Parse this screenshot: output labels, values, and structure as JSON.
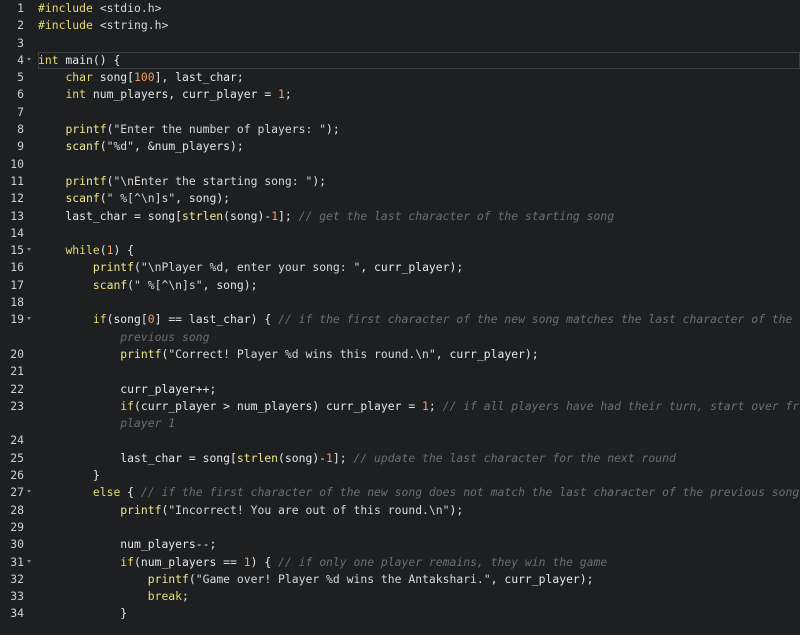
{
  "editor": {
    "lines": [
      {
        "n": "1",
        "fold": false,
        "t": [
          {
            "c": "kw",
            "v": "#include"
          },
          {
            "c": "str",
            "v": " <stdio.h>"
          }
        ]
      },
      {
        "n": "2",
        "fold": false,
        "t": [
          {
            "c": "kw",
            "v": "#include"
          },
          {
            "c": "str",
            "v": " <string.h>"
          }
        ]
      },
      {
        "n": "3",
        "fold": false,
        "t": []
      },
      {
        "n": "4",
        "fold": true,
        "active": true,
        "t": [
          {
            "c": "kw",
            "v": "int"
          },
          {
            "c": "var",
            "v": " main() {"
          }
        ]
      },
      {
        "n": "5",
        "fold": false,
        "t": [
          {
            "c": "var",
            "v": "    "
          },
          {
            "c": "kw",
            "v": "char"
          },
          {
            "c": "var",
            "v": " song["
          },
          {
            "c": "num",
            "v": "100"
          },
          {
            "c": "var",
            "v": "], last_char;"
          }
        ]
      },
      {
        "n": "6",
        "fold": false,
        "t": [
          {
            "c": "var",
            "v": "    "
          },
          {
            "c": "kw",
            "v": "int"
          },
          {
            "c": "var",
            "v": " num_players, curr_player = "
          },
          {
            "c": "num",
            "v": "1"
          },
          {
            "c": "var",
            "v": ";"
          }
        ]
      },
      {
        "n": "7",
        "fold": false,
        "t": []
      },
      {
        "n": "8",
        "fold": false,
        "t": [
          {
            "c": "var",
            "v": "    "
          },
          {
            "c": "fn",
            "v": "printf"
          },
          {
            "c": "var",
            "v": "("
          },
          {
            "c": "str",
            "v": "\"Enter the number of players: \""
          },
          {
            "c": "var",
            "v": ");"
          }
        ]
      },
      {
        "n": "9",
        "fold": false,
        "t": [
          {
            "c": "var",
            "v": "    "
          },
          {
            "c": "fn",
            "v": "scanf"
          },
          {
            "c": "var",
            "v": "("
          },
          {
            "c": "str",
            "v": "\"%d\""
          },
          {
            "c": "var",
            "v": ", &num_players);"
          }
        ]
      },
      {
        "n": "10",
        "fold": false,
        "t": []
      },
      {
        "n": "11",
        "fold": false,
        "t": [
          {
            "c": "var",
            "v": "    "
          },
          {
            "c": "fn",
            "v": "printf"
          },
          {
            "c": "var",
            "v": "("
          },
          {
            "c": "str",
            "v": "\"\\nEnter the starting song: \""
          },
          {
            "c": "var",
            "v": ");"
          }
        ]
      },
      {
        "n": "12",
        "fold": false,
        "t": [
          {
            "c": "var",
            "v": "    "
          },
          {
            "c": "fn",
            "v": "scanf"
          },
          {
            "c": "var",
            "v": "("
          },
          {
            "c": "str",
            "v": "\" %[^\\n]s\""
          },
          {
            "c": "var",
            "v": ", song);"
          }
        ]
      },
      {
        "n": "13",
        "fold": false,
        "t": [
          {
            "c": "var",
            "v": "    last_char = song["
          },
          {
            "c": "fn",
            "v": "strlen"
          },
          {
            "c": "var",
            "v": "(song)-"
          },
          {
            "c": "num",
            "v": "1"
          },
          {
            "c": "var",
            "v": "]; "
          },
          {
            "c": "cmt",
            "v": "// get the last character of the starting song"
          }
        ]
      },
      {
        "n": "14",
        "fold": false,
        "t": []
      },
      {
        "n": "15",
        "fold": true,
        "t": [
          {
            "c": "var",
            "v": "    "
          },
          {
            "c": "kw",
            "v": "while"
          },
          {
            "c": "var",
            "v": "("
          },
          {
            "c": "num",
            "v": "1"
          },
          {
            "c": "var",
            "v": ") {"
          }
        ]
      },
      {
        "n": "16",
        "fold": false,
        "t": [
          {
            "c": "var",
            "v": "        "
          },
          {
            "c": "fn",
            "v": "printf"
          },
          {
            "c": "var",
            "v": "("
          },
          {
            "c": "str",
            "v": "\"\\nPlayer %d, enter your song: \""
          },
          {
            "c": "var",
            "v": ", curr_player);"
          }
        ]
      },
      {
        "n": "17",
        "fold": false,
        "t": [
          {
            "c": "var",
            "v": "        "
          },
          {
            "c": "fn",
            "v": "scanf"
          },
          {
            "c": "var",
            "v": "("
          },
          {
            "c": "str",
            "v": "\" %[^\\n]s\""
          },
          {
            "c": "var",
            "v": ", song);"
          }
        ]
      },
      {
        "n": "18",
        "fold": false,
        "t": []
      },
      {
        "n": "19",
        "fold": true,
        "t": [
          {
            "c": "var",
            "v": "        "
          },
          {
            "c": "kw",
            "v": "if"
          },
          {
            "c": "var",
            "v": "(song["
          },
          {
            "c": "num",
            "v": "0"
          },
          {
            "c": "var",
            "v": "] == last_char) { "
          },
          {
            "c": "cmt",
            "v": "// if the first character of the new song matches the last character of the"
          }
        ],
        "cont": [
          {
            "c": "cmt",
            "v": "            previous song"
          }
        ]
      },
      {
        "n": "20",
        "fold": false,
        "t": [
          {
            "c": "var",
            "v": "            "
          },
          {
            "c": "fn",
            "v": "printf"
          },
          {
            "c": "var",
            "v": "("
          },
          {
            "c": "str",
            "v": "\"Correct! Player %d wins this round.\\n\""
          },
          {
            "c": "var",
            "v": ", curr_player);"
          }
        ]
      },
      {
        "n": "21",
        "fold": false,
        "t": []
      },
      {
        "n": "22",
        "fold": false,
        "t": [
          {
            "c": "var",
            "v": "            curr_player++;"
          }
        ]
      },
      {
        "n": "23",
        "fold": false,
        "t": [
          {
            "c": "var",
            "v": "            "
          },
          {
            "c": "kw",
            "v": "if"
          },
          {
            "c": "var",
            "v": "(curr_player > num_players) curr_player = "
          },
          {
            "c": "num",
            "v": "1"
          },
          {
            "c": "var",
            "v": "; "
          },
          {
            "c": "cmt",
            "v": "// if all players have had their turn, start over from"
          }
        ],
        "cont": [
          {
            "c": "cmt",
            "v": "            player 1"
          }
        ]
      },
      {
        "n": "24",
        "fold": false,
        "t": []
      },
      {
        "n": "25",
        "fold": false,
        "t": [
          {
            "c": "var",
            "v": "            last_char = song["
          },
          {
            "c": "fn",
            "v": "strlen"
          },
          {
            "c": "var",
            "v": "(song)-"
          },
          {
            "c": "num",
            "v": "1"
          },
          {
            "c": "var",
            "v": "]; "
          },
          {
            "c": "cmt",
            "v": "// update the last character for the next round"
          }
        ]
      },
      {
        "n": "26",
        "fold": false,
        "t": [
          {
            "c": "var",
            "v": "        }"
          }
        ]
      },
      {
        "n": "27",
        "fold": true,
        "t": [
          {
            "c": "var",
            "v": "        "
          },
          {
            "c": "kw",
            "v": "else"
          },
          {
            "c": "var",
            "v": " { "
          },
          {
            "c": "cmt",
            "v": "// if the first character of the new song does not match the last character of the previous song"
          }
        ]
      },
      {
        "n": "28",
        "fold": false,
        "t": [
          {
            "c": "var",
            "v": "            "
          },
          {
            "c": "fn",
            "v": "printf"
          },
          {
            "c": "var",
            "v": "("
          },
          {
            "c": "str",
            "v": "\"Incorrect! You are out of this round.\\n\""
          },
          {
            "c": "var",
            "v": ");"
          }
        ]
      },
      {
        "n": "29",
        "fold": false,
        "t": []
      },
      {
        "n": "30",
        "fold": false,
        "t": [
          {
            "c": "var",
            "v": "            num_players--;"
          }
        ]
      },
      {
        "n": "31",
        "fold": true,
        "t": [
          {
            "c": "var",
            "v": "            "
          },
          {
            "c": "kw",
            "v": "if"
          },
          {
            "c": "var",
            "v": "(num_players == "
          },
          {
            "c": "num",
            "v": "1"
          },
          {
            "c": "var",
            "v": ") { "
          },
          {
            "c": "cmt",
            "v": "// if only one player remains, they win the game"
          }
        ]
      },
      {
        "n": "32",
        "fold": false,
        "t": [
          {
            "c": "var",
            "v": "                "
          },
          {
            "c": "fn",
            "v": "printf"
          },
          {
            "c": "var",
            "v": "("
          },
          {
            "c": "str",
            "v": "\"Game over! Player %d wins the Antakshari.\""
          },
          {
            "c": "var",
            "v": ", curr_player);"
          }
        ]
      },
      {
        "n": "33",
        "fold": false,
        "t": [
          {
            "c": "var",
            "v": "                "
          },
          {
            "c": "kw",
            "v": "break"
          },
          {
            "c": "var",
            "v": ";"
          }
        ]
      },
      {
        "n": "34",
        "fold": false,
        "t": [
          {
            "c": "var",
            "v": "            }"
          }
        ]
      }
    ]
  }
}
